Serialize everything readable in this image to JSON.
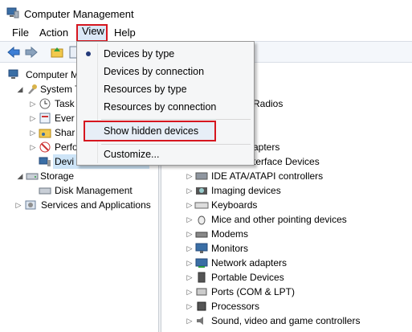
{
  "window": {
    "title": "Computer Management"
  },
  "menubar": {
    "file": "File",
    "action": "Action",
    "view": "View",
    "help": "Help"
  },
  "view_menu": {
    "items": [
      {
        "label": "Devices by type",
        "checked": true
      },
      {
        "label": "Devices by connection"
      },
      {
        "label": "Resources by type"
      },
      {
        "label": "Resources by connection"
      },
      {
        "label": "Show hidden devices"
      },
      {
        "label": "Customize..."
      }
    ]
  },
  "tree": {
    "root": "Computer M",
    "system_tools": "System T",
    "task": "Task",
    "event": "Ever",
    "shared": "Shar",
    "perf": "Perfo",
    "device_mgr": "Devi",
    "storage": "Storage",
    "disk_mgmt": "Disk Management",
    "services": "Services and Applications"
  },
  "devices": {
    "partial": [
      "Radios",
      "apters",
      "terface Devices"
    ],
    "items": [
      "IDE ATA/ATAPI controllers",
      "Imaging devices",
      "Keyboards",
      "Mice and other pointing devices",
      "Modems",
      "Monitors",
      "Network adapters",
      "Portable Devices",
      "Ports (COM & LPT)",
      "Processors",
      "Sound, video and game controllers"
    ]
  },
  "colors": {
    "highlight_border": "#d6161f",
    "menu_bg": "#f5f6f7"
  }
}
